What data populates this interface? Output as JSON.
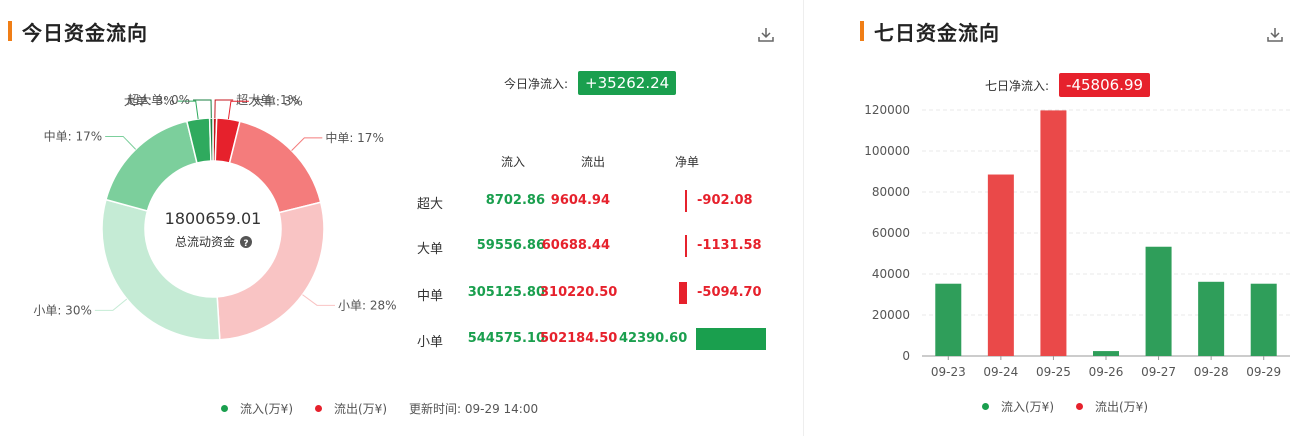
{
  "today": {
    "title": "今日资金流向",
    "net_label": "今日净流入:",
    "net_value": "+35262.24",
    "donut_center_value": "1800659.01",
    "donut_center_label": "总流动资金",
    "table_headers": {
      "in": "流入",
      "out": "流出",
      "net": "净单"
    },
    "rows": [
      {
        "label": "超大",
        "in": "8702.86",
        "out": "9604.94",
        "net": "-902.08",
        "net_num": -902.08
      },
      {
        "label": "大单",
        "in": "59556.86",
        "out": "60688.44",
        "net": "-1131.58",
        "net_num": -1131.58
      },
      {
        "label": "中单",
        "in": "305125.80",
        "out": "310220.50",
        "net": "-5094.70",
        "net_num": -5094.7
      },
      {
        "label": "小单",
        "in": "544575.10",
        "out": "502184.50",
        "net": "42390.60",
        "net_num": 42390.6
      }
    ],
    "legend": {
      "in": "流入(万¥)",
      "out": "流出(万¥)",
      "update": "更新时间: 09-29 14:00"
    }
  },
  "week": {
    "title": "七日资金流向",
    "net_label": "七日净流入:",
    "net_value": "-45806.99"
  },
  "colors": {
    "green": "#1a9f4e",
    "red": "#e6212c",
    "accent": "#f07e16"
  },
  "icons": {
    "download": "download-icon",
    "help": "question-circle-icon"
  },
  "chart_data": [
    {
      "type": "pie",
      "variant": "donut",
      "categories": [
        "超大单",
        "大单",
        "中单",
        "小单",
        "小单",
        "中单",
        "大单",
        "超大单"
      ],
      "flow": [
        "out",
        "out",
        "out",
        "out",
        "in",
        "in",
        "in",
        "in"
      ],
      "values": [
        9604.94,
        60688.44,
        310220.5,
        502184.5,
        544575.1,
        305125.8,
        59556.86,
        8702.86
      ],
      "slice_labels": [
        "超大单: 1%",
        "大单: 3%",
        "中单: 17%",
        "小单: 28%",
        "小单: 30%",
        "中单: 17%",
        "大单: 3%",
        "超大单: 0%"
      ],
      "slice_colors": [
        "#c4161c",
        "#e6212c",
        "#f47c7c",
        "#f9c4c4",
        "#c5ebd5",
        "#7ccf9c",
        "#2faa5e",
        "#1a7f41"
      ]
    },
    {
      "type": "bar",
      "categories": [
        "09-23",
        "09-24",
        "09-25",
        "09-26",
        "09-27",
        "09-28",
        "09-29"
      ],
      "values": [
        35262,
        88523,
        119800,
        2400,
        53300,
        36200,
        35262
      ],
      "direction": [
        "in",
        "out",
        "out",
        "in",
        "in",
        "in",
        "in"
      ],
      "ylim": [
        0,
        120000
      ],
      "yticks": [
        0,
        20000,
        40000,
        60000,
        80000,
        100000,
        120000
      ],
      "grid": true,
      "legend": [
        "流入(万¥)",
        "流出(万¥)"
      ],
      "legend_position": "bottom"
    }
  ]
}
